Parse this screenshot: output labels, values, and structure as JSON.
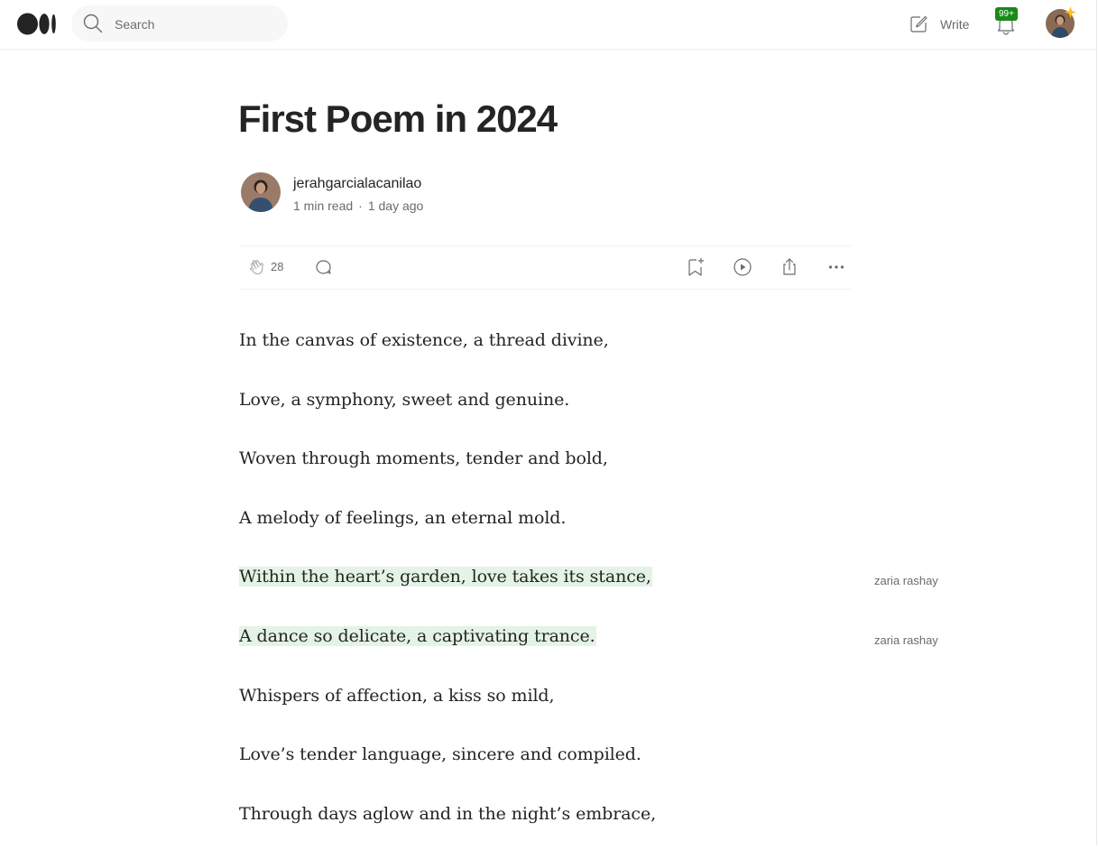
{
  "topbar": {
    "search_placeholder": "Search",
    "write_label": "Write",
    "notification_badge": "99+"
  },
  "article": {
    "title": "First Poem in 2024",
    "author": "jerahgarcialacanilao",
    "read_time": "1 min read",
    "published": "1 day ago",
    "claps": "28"
  },
  "poem": {
    "lines": [
      "In the canvas of existence, a thread divine,",
      "Love, a symphony, sweet and genuine.",
      "Woven through moments, tender and bold,",
      "A melody of feelings, an eternal mold.",
      "Within the heart’s garden, love takes its stance,",
      "A dance so delicate, a captivating trance.",
      "Whispers of affection, a kiss so mild,",
      "Love’s tender language, sincere and compiled.",
      "Through days aglow and in the night’s embrace,"
    ],
    "highlights": [
      {
        "line": 5,
        "by": "zaria rashay"
      },
      {
        "line": 6,
        "by": "zaria rashay"
      }
    ]
  },
  "colors": {
    "highlight": "#e3f3e5",
    "badge": "#1a8917",
    "text": "#242424",
    "muted": "#6b6b6b"
  }
}
